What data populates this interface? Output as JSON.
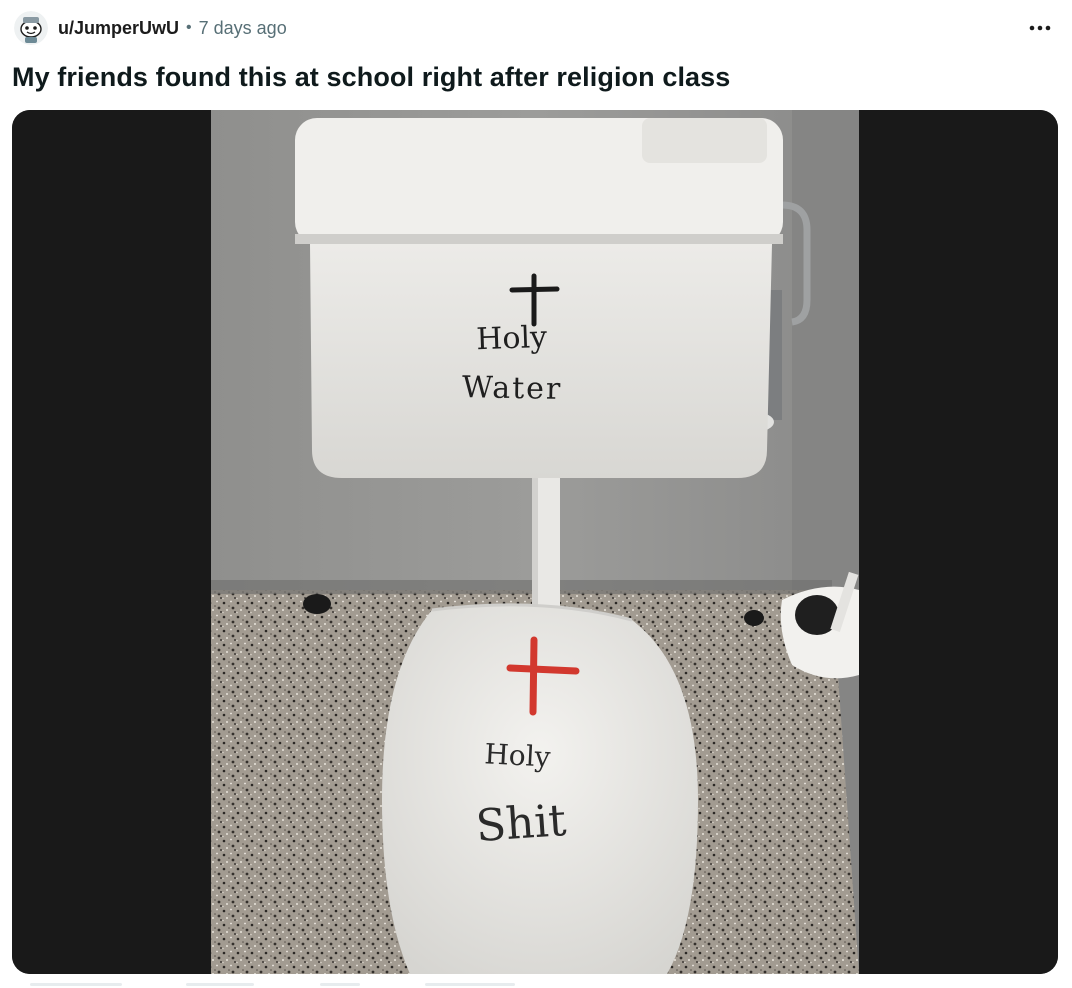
{
  "post": {
    "author": "u/JumperUwU",
    "separator": "•",
    "time_ago": "7 days ago",
    "title": "My friends found this at school right after religion class",
    "more_icon": "three-dots-horizontal-icon"
  },
  "image": {
    "tank_text_line1": "Holy",
    "tank_text_line2": "Water",
    "seat_text_line1": "Holy",
    "seat_text_line2": "Shit"
  },
  "colors": {
    "title": "#0f1a1c",
    "meta": "#576f76",
    "cross_black": "#1a1a1a",
    "cross_red": "#d2382e"
  }
}
